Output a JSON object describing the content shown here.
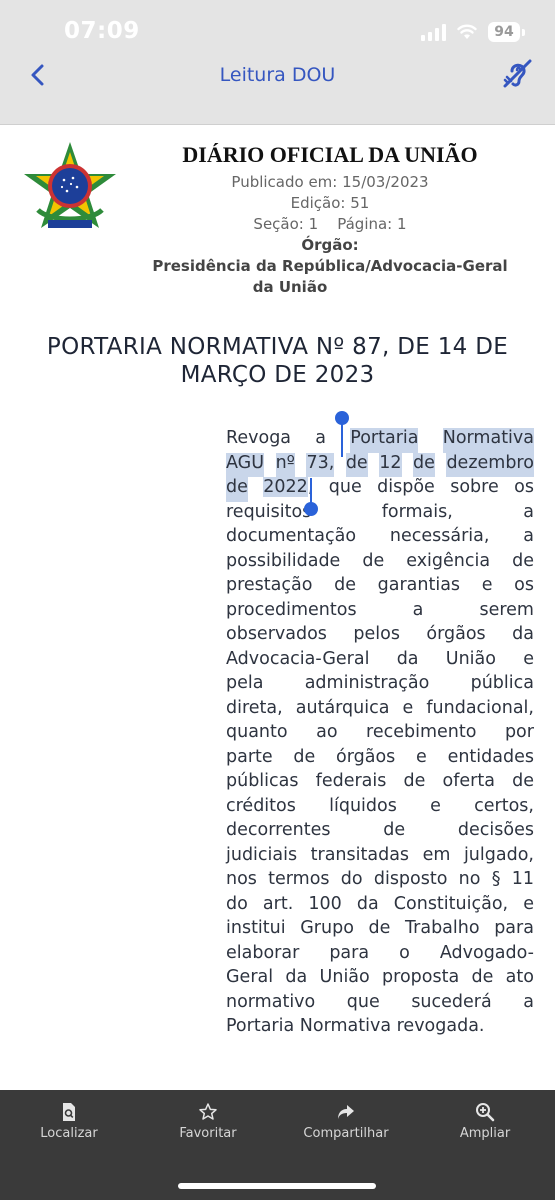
{
  "status": {
    "time": "07:09",
    "battery": "94"
  },
  "nav": {
    "title": "Leitura DOU",
    "back_icon": "chevron-left-icon",
    "accessibility_icon": "hearing-accessibility-icon",
    "accent": "#3556c0"
  },
  "header": {
    "title": "DIÁRIO OFICIAL DA UNIÃO",
    "published": "Publicado em: 15/03/2023",
    "edition": "Edição: 51",
    "section": "Seção: 1",
    "page": "Página: 1",
    "organ_label": "Órgão:",
    "organ_line1": "Presidência da República/Advocacia-Geral",
    "organ_line2": "da União"
  },
  "document": {
    "title_line1": "PORTARIA NORMATIVA Nº 87, DE 14 DE",
    "title_line2": "MARÇO DE 2023",
    "ementa_lines": [
      [
        "Revoga",
        "a",
        "Portaria",
        "Normativa"
      ],
      [
        "AGU",
        "nº",
        "73,",
        "de",
        "12",
        "de",
        "dezembro"
      ],
      [
        "de",
        "2022,",
        "que",
        "dispõe",
        "sobre",
        "os"
      ],
      [
        "requisitos",
        "formais,",
        "a"
      ],
      [
        "documentação",
        "necessária,",
        "a"
      ],
      [
        "possibilidade",
        "de",
        "exigência",
        "de"
      ],
      [
        "prestação",
        "de",
        "garantias",
        "e",
        "os"
      ],
      [
        "procedimentos",
        "a",
        "serem"
      ],
      [
        "observados",
        "pelos",
        "órgãos",
        "da"
      ],
      [
        "Advocacia-Geral",
        "da",
        "União",
        "e"
      ],
      [
        "pela",
        "administração",
        "pública"
      ],
      [
        "direta,",
        "autárquica",
        "e",
        "fundacional,"
      ],
      [
        "quanto",
        "ao",
        "recebimento",
        "por"
      ],
      [
        "parte",
        "de",
        "órgãos",
        "e",
        "entidades"
      ],
      [
        "públicas",
        "federais",
        "de",
        "oferta",
        "de"
      ],
      [
        "créditos",
        "líquidos",
        "e",
        "certos,"
      ],
      [
        "decorrentes",
        "de",
        "decisões"
      ],
      [
        "judiciais",
        "transitadas",
        "em",
        "julgado,"
      ],
      [
        "nos",
        "termos",
        "do",
        "disposto",
        "no",
        "§",
        "11"
      ],
      [
        "do",
        "art.",
        "100",
        "da",
        "Constituição,",
        "e"
      ],
      [
        "institui",
        "Grupo",
        "de",
        "Trabalho",
        "para"
      ],
      [
        "elaborar",
        "para",
        "o",
        "Advogado-"
      ],
      [
        "Geral",
        "da",
        "União",
        "proposta",
        "de",
        "ato"
      ],
      [
        "normativo",
        "que",
        "sucederá",
        "a"
      ],
      [
        "Portaria",
        "Normativa",
        "revogada."
      ]
    ],
    "selected_text": "Portaria Normativa AGU nº 73, de 12 de dezembro de 2022",
    "selection_color": "#c9d6ea",
    "caret_color": "#2a62d9"
  },
  "toolbar": {
    "items": [
      {
        "label": "Localizar",
        "icon": "find-document-icon"
      },
      {
        "label": "Favoritar",
        "icon": "star-icon"
      },
      {
        "label": "Compartilhar",
        "icon": "share-arrow-icon"
      },
      {
        "label": "Ampliar",
        "icon": "zoom-in-icon"
      }
    ]
  }
}
